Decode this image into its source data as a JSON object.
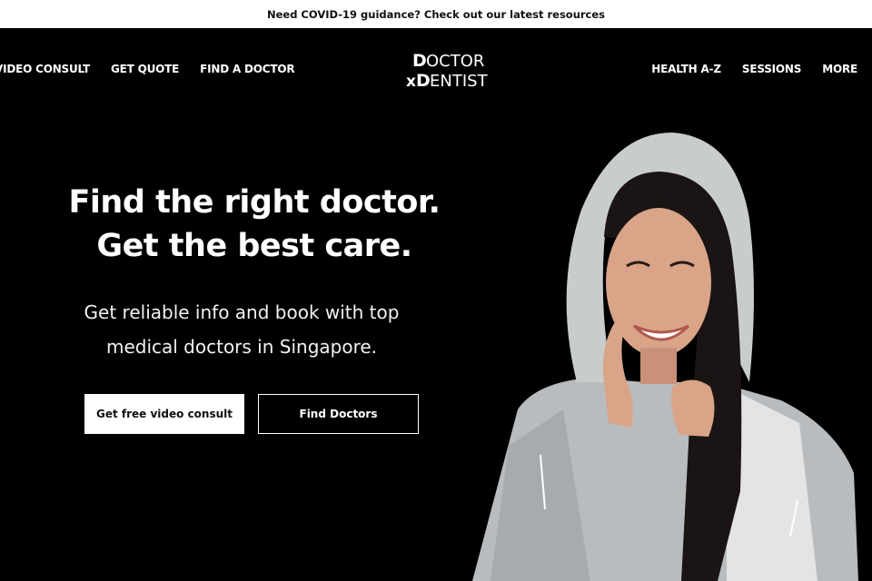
{
  "announcement": {
    "text": "Need COVID-19 guidance? Check out our latest resources"
  },
  "nav": {
    "left": [
      "VIDEO CONSULT",
      "GET QUOTE",
      "FIND A DOCTOR"
    ],
    "right": [
      "HEALTH A-Z",
      "SESSIONS",
      "MORE"
    ]
  },
  "logo": {
    "line1": "DOCTOR",
    "line2": "DENTIST",
    "prefix": "x"
  },
  "hero": {
    "headline_line1": "Find the right doctor.",
    "headline_line2": "Get the best care.",
    "sub_line1": "Get reliable info and book with top",
    "sub_line2": "medical doctors in Singapore.",
    "primary_button": "Get free video consult",
    "secondary_button": "Find Doctors"
  },
  "colors": {
    "background": "#000000",
    "announcement_bg": "#ffffff",
    "text": "#ffffff"
  }
}
